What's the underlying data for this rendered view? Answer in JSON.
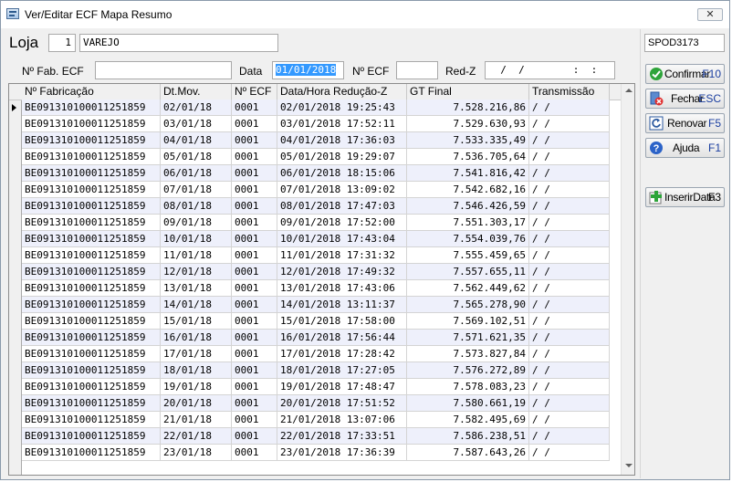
{
  "window": {
    "title": "Ver/Editar ECF Mapa Resumo",
    "close_glyph": "✕"
  },
  "loja": {
    "label": "Loja",
    "number": "1",
    "name": "VAREJO"
  },
  "side_code": "SPOD3173",
  "filters": {
    "fab_label": "Nº Fab. ECF",
    "fab_value": "",
    "data_label": "Data",
    "data_value": "01/01/2018",
    "ecf_label": "Nº ECF",
    "ecf_value": "",
    "redz_label": "Red-Z",
    "redz_value": "  /  /        :  :"
  },
  "grid": {
    "columns": [
      "Nº Fabricação",
      "Dt.Mov.",
      "Nº ECF",
      "Data/Hora Redução-Z",
      "GT Final",
      "Transmissão"
    ],
    "rows": [
      [
        "BE091310100011251859",
        "02/01/18",
        "0001",
        "02/01/2018 19:25:43",
        "7.528.216,86",
        "/  /"
      ],
      [
        "BE091310100011251859",
        "03/01/18",
        "0001",
        "03/01/2018 17:52:11",
        "7.529.630,93",
        "/  /"
      ],
      [
        "BE091310100011251859",
        "04/01/18",
        "0001",
        "04/01/2018 17:36:03",
        "7.533.335,49",
        "/  /"
      ],
      [
        "BE091310100011251859",
        "05/01/18",
        "0001",
        "05/01/2018 19:29:07",
        "7.536.705,64",
        "/  /"
      ],
      [
        "BE091310100011251859",
        "06/01/18",
        "0001",
        "06/01/2018 18:15:06",
        "7.541.816,42",
        "/  /"
      ],
      [
        "BE091310100011251859",
        "07/01/18",
        "0001",
        "07/01/2018 13:09:02",
        "7.542.682,16",
        "/  /"
      ],
      [
        "BE091310100011251859",
        "08/01/18",
        "0001",
        "08/01/2018 17:47:03",
        "7.546.426,59",
        "/  /"
      ],
      [
        "BE091310100011251859",
        "09/01/18",
        "0001",
        "09/01/2018 17:52:00",
        "7.551.303,17",
        "/  /"
      ],
      [
        "BE091310100011251859",
        "10/01/18",
        "0001",
        "10/01/2018 17:43:04",
        "7.554.039,76",
        "/  /"
      ],
      [
        "BE091310100011251859",
        "11/01/18",
        "0001",
        "11/01/2018 17:31:32",
        "7.555.459,65",
        "/  /"
      ],
      [
        "BE091310100011251859",
        "12/01/18",
        "0001",
        "12/01/2018 17:49:32",
        "7.557.655,11",
        "/  /"
      ],
      [
        "BE091310100011251859",
        "13/01/18",
        "0001",
        "13/01/2018 17:43:06",
        "7.562.449,62",
        "/  /"
      ],
      [
        "BE091310100011251859",
        "14/01/18",
        "0001",
        "14/01/2018 13:11:37",
        "7.565.278,90",
        "/  /"
      ],
      [
        "BE091310100011251859",
        "15/01/18",
        "0001",
        "15/01/2018 17:58:00",
        "7.569.102,51",
        "/  /"
      ],
      [
        "BE091310100011251859",
        "16/01/18",
        "0001",
        "16/01/2018 17:56:44",
        "7.571.621,35",
        "/  /"
      ],
      [
        "BE091310100011251859",
        "17/01/18",
        "0001",
        "17/01/2018 17:28:42",
        "7.573.827,84",
        "/  /"
      ],
      [
        "BE091310100011251859",
        "18/01/18",
        "0001",
        "18/01/2018 17:27:05",
        "7.576.272,89",
        "/  /"
      ],
      [
        "BE091310100011251859",
        "19/01/18",
        "0001",
        "19/01/2018 17:48:47",
        "7.578.083,23",
        "/  /"
      ],
      [
        "BE091310100011251859",
        "20/01/18",
        "0001",
        "20/01/2018 17:51:52",
        "7.580.661,19",
        "/  /"
      ],
      [
        "BE091310100011251859",
        "21/01/18",
        "0001",
        "21/01/2018 13:07:06",
        "7.582.495,69",
        "/  /"
      ],
      [
        "BE091310100011251859",
        "22/01/18",
        "0001",
        "22/01/2018 17:33:51",
        "7.586.238,51",
        "/  /"
      ],
      [
        "BE091310100011251859",
        "23/01/18",
        "0001",
        "23/01/2018 17:36:39",
        "7.587.643,26",
        "/  /"
      ]
    ]
  },
  "buttons": {
    "confirmar": {
      "label": "Confirmar",
      "key": "F10",
      "icon": "check-icon"
    },
    "fechar": {
      "label": "Fechar",
      "key": "ESC",
      "icon": "close-door-icon"
    },
    "renovar": {
      "label": "Renovar",
      "key": "F5",
      "icon": "refresh-icon"
    },
    "ajuda": {
      "label": "Ajuda",
      "key": "F1",
      "icon": "help-icon"
    },
    "inserir": {
      "label": "InserirData",
      "key": "F3",
      "icon": "add-icon"
    }
  },
  "colors": {
    "row_alt": "#eef0fb",
    "selection": "#3399ff",
    "key_text": "#1a3ea0"
  }
}
